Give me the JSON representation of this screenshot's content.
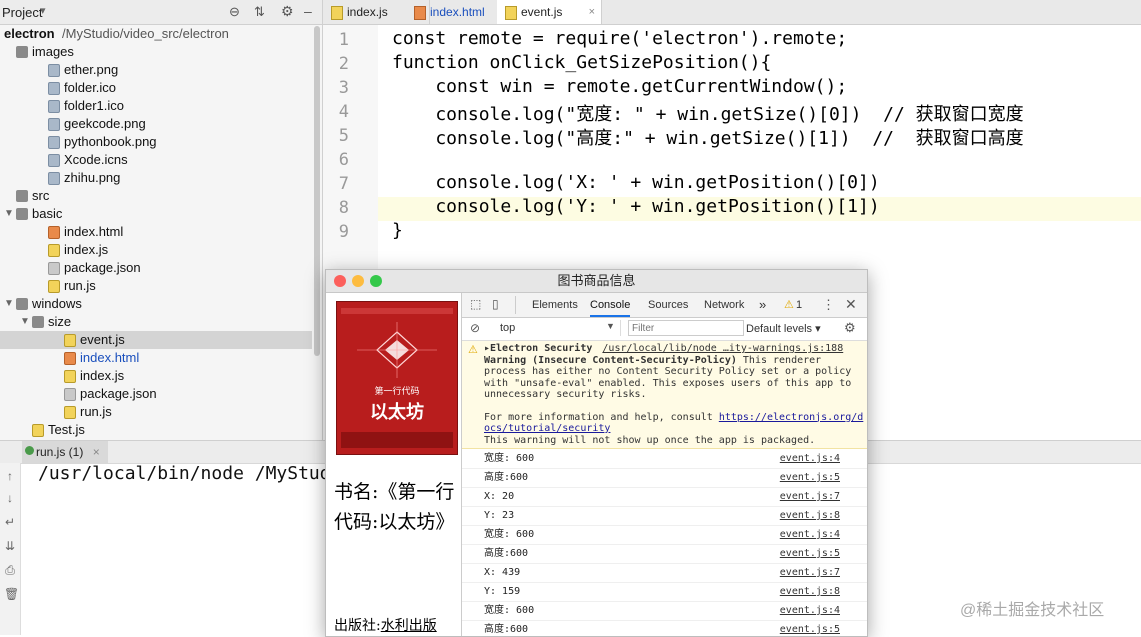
{
  "project": {
    "header_label": "Project",
    "header_arrow": "▾",
    "root_name": "electron",
    "root_path": "/MyStudio/video_src/electron",
    "items": [
      {
        "label": "images",
        "kind": "folder",
        "indent": 0
      },
      {
        "label": "ether.png",
        "kind": "file",
        "indent": 1
      },
      {
        "label": "folder.ico",
        "kind": "file",
        "indent": 1
      },
      {
        "label": "folder1.ico",
        "kind": "file",
        "indent": 1
      },
      {
        "label": "geekcode.png",
        "kind": "file",
        "indent": 1
      },
      {
        "label": "pythonbook.png",
        "kind": "file",
        "indent": 1
      },
      {
        "label": "Xcode.icns",
        "kind": "file",
        "indent": 1
      },
      {
        "label": "zhihu.png",
        "kind": "file",
        "indent": 1
      },
      {
        "label": "src",
        "kind": "folder",
        "indent": 0
      },
      {
        "label": "basic",
        "kind": "folder",
        "indent": 0
      },
      {
        "label": "index.html",
        "kind": "html",
        "indent": 1
      },
      {
        "label": "index.js",
        "kind": "js",
        "indent": 1
      },
      {
        "label": "package.json",
        "kind": "json",
        "indent": 1
      },
      {
        "label": "run.js",
        "kind": "js",
        "indent": 1
      },
      {
        "label": "windows",
        "kind": "folder",
        "indent": 0
      },
      {
        "label": "size",
        "kind": "folder",
        "indent": 1
      },
      {
        "label": "event.js",
        "kind": "js",
        "indent": 2,
        "selected": true
      },
      {
        "label": "index.html",
        "kind": "html",
        "indent": 2,
        "highlight": true
      },
      {
        "label": "index.js",
        "kind": "js",
        "indent": 2
      },
      {
        "label": "package.json",
        "kind": "json",
        "indent": 2
      },
      {
        "label": "run.js",
        "kind": "js",
        "indent": 2
      },
      {
        "label": "Test.js",
        "kind": "js",
        "indent": 0
      }
    ]
  },
  "editor": {
    "tabs": [
      {
        "label": "index.js",
        "active": false
      },
      {
        "label": "index.html",
        "active": false
      },
      {
        "label": "event.js",
        "active": true
      }
    ],
    "tab_close": "×",
    "line_numbers": [
      "1",
      "2",
      "3",
      "4",
      "5",
      "6",
      "7",
      "8",
      "9"
    ],
    "lines": [
      "const remote = require('electron').remote;",
      "function onClick_GetSizePosition(){",
      "    const win = remote.getCurrentWindow();",
      "    console.log(\"宽度: \" + win.getSize()[0])  // 获取窗口宽度",
      "    console.log(\"高度:\" + win.getSize()[1])  //  获取窗口高度",
      "",
      "    console.log('X: ' + win.getPosition()[0])",
      "    console.log('Y: ' + win.getPosition()[1])",
      "}"
    ]
  },
  "run": {
    "tab_label": "run.js (1)",
    "output": "/usr/local/bin/node /MyStud"
  },
  "app_window": {
    "title": "图书商品信息",
    "book": {
      "cover_series": "第一行代码",
      "cover_title": "以太坊",
      "title_text": "书名:《第一行代码:以太坊》",
      "publisher_label": "出版社:",
      "publisher_value": "水利出版"
    }
  },
  "devtools": {
    "tabs": [
      "Elements",
      "Console",
      "Sources",
      "Network"
    ],
    "active_tab": "Console",
    "more": "»",
    "warning_count": "1",
    "context": "top",
    "filter_placeholder": "Filter",
    "levels": "Default levels ▾",
    "warning": {
      "title": "▸Electron Security",
      "source": "/usr/local/lib/node …ity-warnings.js:188",
      "heading": "Warning (Insecure Content-Security-Policy)",
      "body": "This renderer process has either no Content Security Policy set or a policy with \"unsafe-eval\" enabled. This exposes users of this app to unnecessary security risks.",
      "help_prefix": "For more information and help, consult",
      "help_link": "https://electronjs.org/docs/tutorial/security",
      "footer": "This warning will not show up once the app is packaged."
    },
    "logs": [
      {
        "msg": "宽度: 600",
        "src": "event.js:4"
      },
      {
        "msg": "高度:600",
        "src": "event.js:5"
      },
      {
        "msg": "X: 20",
        "src": "event.js:7"
      },
      {
        "msg": "Y: 23",
        "src": "event.js:8"
      },
      {
        "msg": "宽度: 600",
        "src": "event.js:4"
      },
      {
        "msg": "高度:600",
        "src": "event.js:5"
      },
      {
        "msg": "X: 439",
        "src": "event.js:7"
      },
      {
        "msg": "Y: 159",
        "src": "event.js:8"
      },
      {
        "msg": "宽度: 600",
        "src": "event.js:4"
      },
      {
        "msg": "高度:600",
        "src": "event.js:5"
      }
    ]
  },
  "watermark": "@稀土掘金技术社区",
  "colors": {
    "accent": "#1a73e8",
    "warning": "#f0b400",
    "selection": "#d4d4d4",
    "book_red": "#b81d1d"
  }
}
